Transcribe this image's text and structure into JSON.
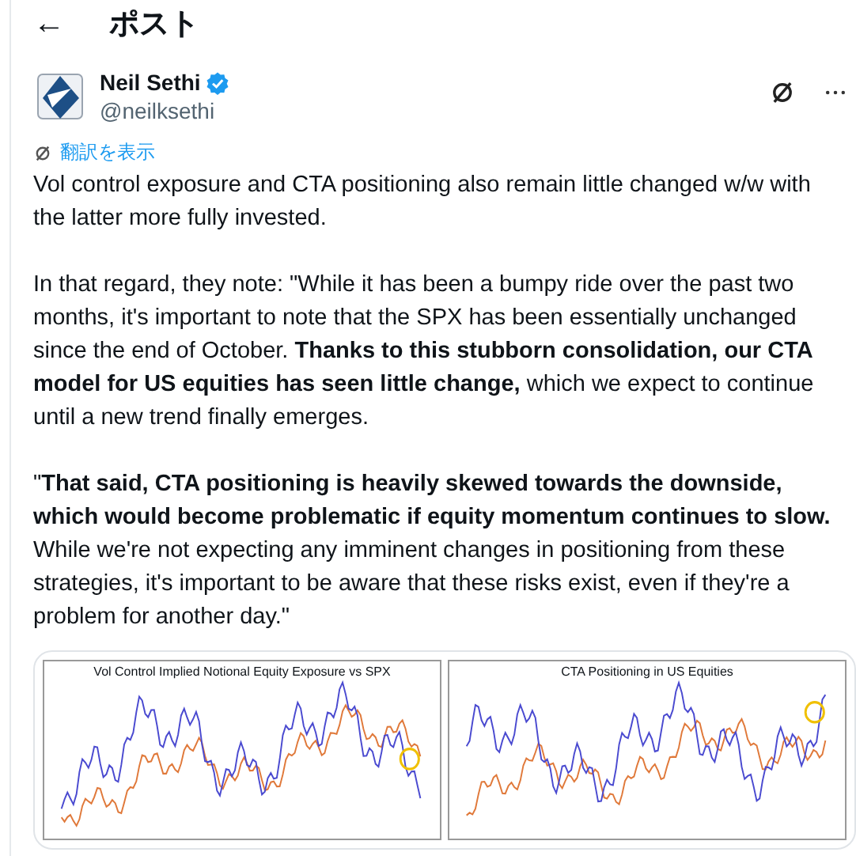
{
  "header": {
    "back_icon": "←",
    "title": "ポスト"
  },
  "author": {
    "name": "Neil Sethi",
    "verified": true,
    "handle": "@neilksethi"
  },
  "translate_link": "翻訳を表示",
  "paragraphs": [
    "Vol control exposure and CTA positioning also remain little changed w/w with the latter more fully invested.",
    "In that regard, they note: \"While it has been a bumpy ride over the past two months, it's important to note that the SPX has been essentially unchanged since the end of October. **Thanks to this stubborn consolidation, our CTA model for US equities has seen little change,** which we expect to continue until a new trend finally emerges.",
    "\"**That said, CTA positioning is heavily skewed towards the downside, which would become problematic if equity momentum continues to slow.** While we're not expecting any imminent changes in positioning from these strategies, it's important to be aware that these risks exist, even if they're a problem for another day.\""
  ],
  "images": [
    {
      "title": "Vol Control Implied Notional Equity Exposure vs SPX"
    },
    {
      "title": "CTA Positioning in US Equities"
    }
  ]
}
